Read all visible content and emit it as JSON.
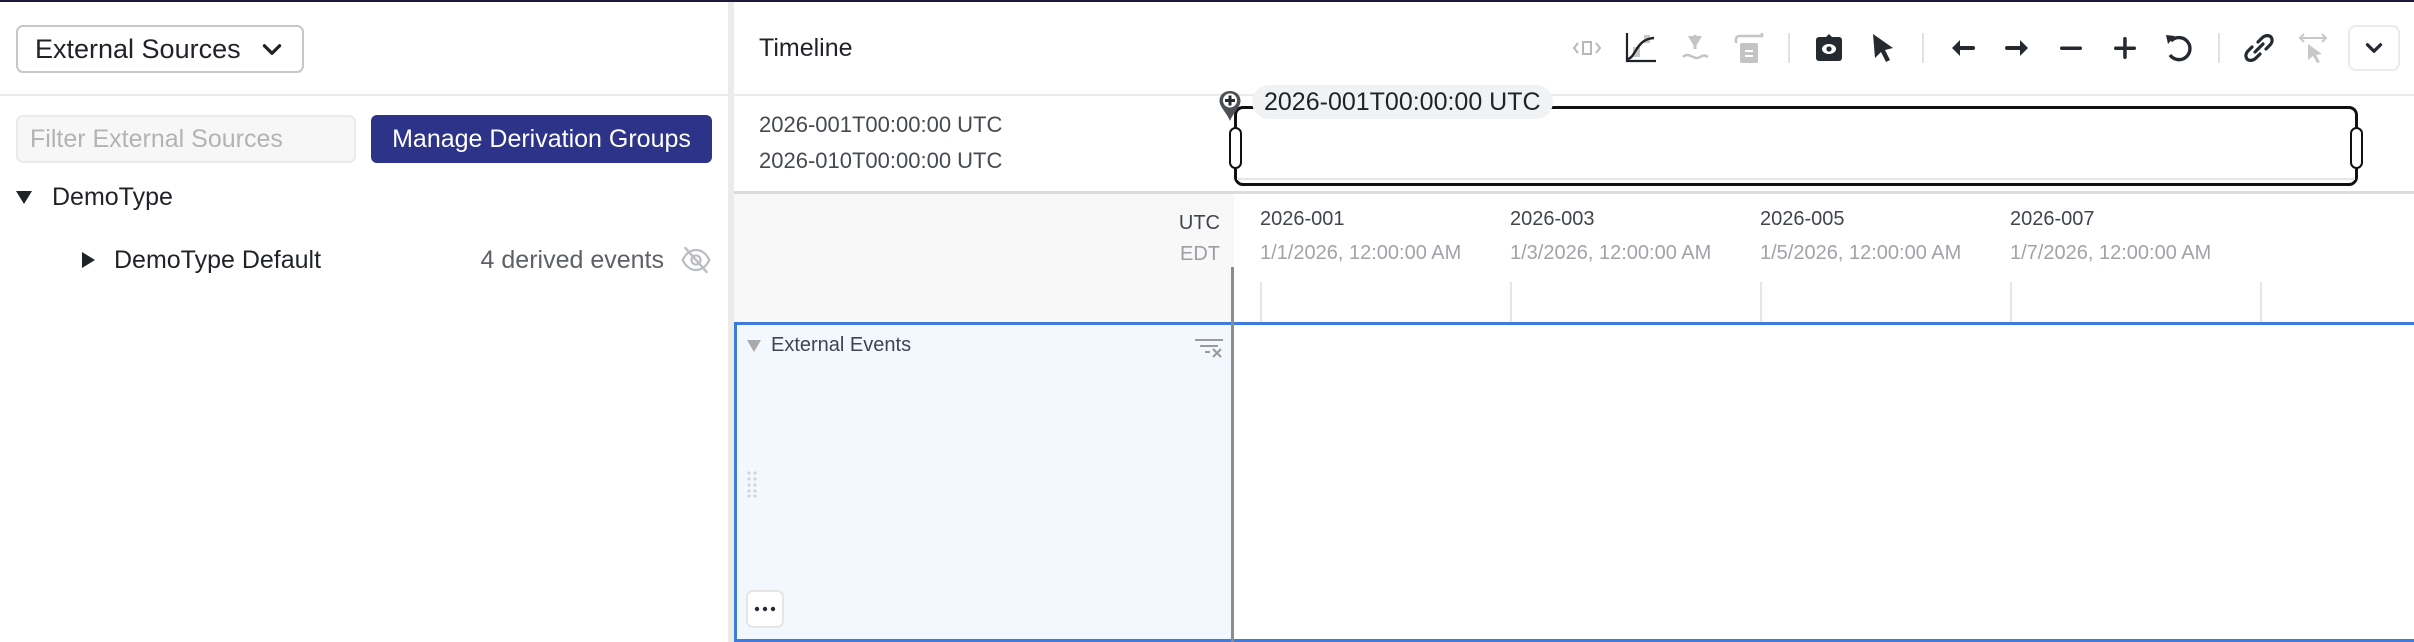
{
  "left_panel": {
    "source_select": {
      "label": "External Sources",
      "icon": "chevron-down-icon"
    },
    "filter": {
      "placeholder": "Filter External Sources",
      "value": ""
    },
    "manage_button": "Manage Derivation Groups",
    "tree": {
      "type": {
        "label": "DemoType",
        "expanded": true
      },
      "groups": [
        {
          "label": "DemoType Default",
          "expanded": false,
          "derived_events": "4 derived events",
          "visibility_icon": "eye-off-icon"
        }
      ]
    }
  },
  "timeline": {
    "title": "Timeline",
    "toolbar": [
      {
        "name": "timeline-editor-icon",
        "enabled": false
      },
      {
        "name": "chart-line-icon",
        "enabled": true
      },
      {
        "name": "merge-down-icon",
        "enabled": false
      },
      {
        "name": "row-layout-icon",
        "enabled": false
      },
      {
        "name": "camera-eye-icon",
        "enabled": true
      },
      {
        "name": "pointer-icon",
        "enabled": true
      },
      {
        "name": "arrow-left-icon",
        "enabled": true
      },
      {
        "name": "arrow-right-icon",
        "enabled": true
      },
      {
        "name": "zoom-out-icon",
        "enabled": true
      },
      {
        "name": "zoom-in-icon",
        "enabled": true
      },
      {
        "name": "reset-icon",
        "enabled": true
      },
      {
        "name": "link-icon",
        "enabled": true
      },
      {
        "name": "cursor-sync-icon",
        "enabled": false
      },
      {
        "name": "chevron-down-icon",
        "enabled": true
      }
    ],
    "range": {
      "start": "2026-001T00:00:00 UTC",
      "end": "2026-010T00:00:00 UTC"
    },
    "axis": {
      "primary_tz": "UTC",
      "secondary_tz": "EDT",
      "ticks": [
        {
          "utc": "2026-001",
          "local": "1/1/2026, 12:00:00 AM"
        },
        {
          "utc": "2026-003",
          "local": "1/3/2026, 12:00:00 AM"
        },
        {
          "utc": "2026-005",
          "local": "1/5/2026, 12:00:00 AM"
        },
        {
          "utc": "2026-007",
          "local": "1/7/2026, 12:00:00 AM"
        }
      ]
    },
    "cursor_label": "2026-001T00:00:00 UTC",
    "rows": [
      {
        "title": "External Events",
        "menu_label": "..."
      }
    ]
  },
  "colors": {
    "primary_button": "#2c3389",
    "row_selected_border": "#3f7bdb",
    "row_label_bg": "#f3f7fe"
  }
}
